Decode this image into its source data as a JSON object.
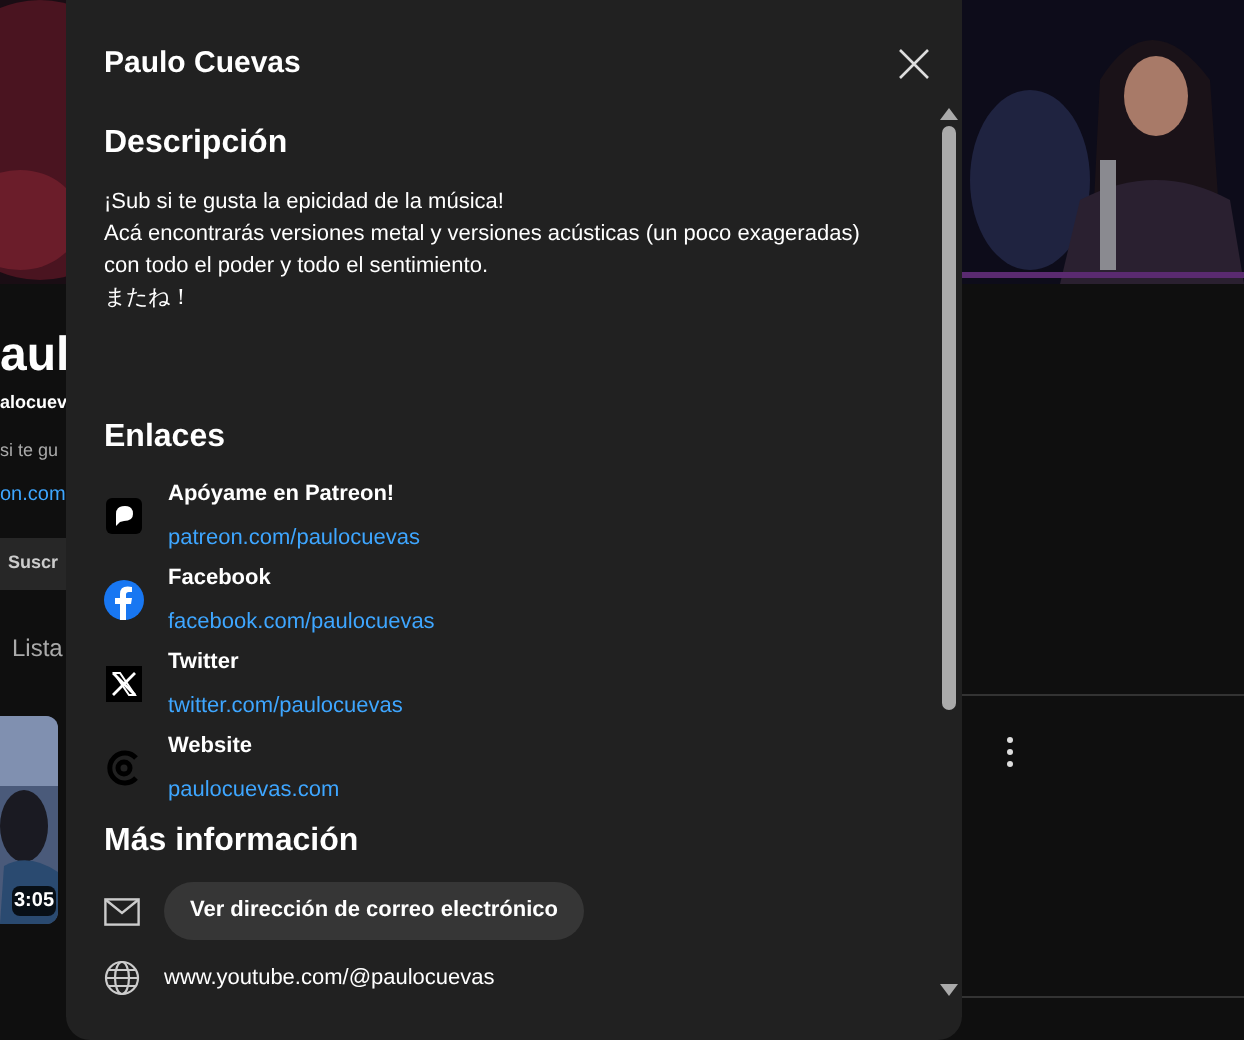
{
  "background_page": {
    "channel_title": "aul",
    "handle": "alocuev",
    "description": "si te gu",
    "link": "on.com",
    "subscribe_button": "Suscr",
    "tab": "Lista",
    "video": {
      "kind": "picture",
      "duration": "3:05"
    }
  },
  "dialog": {
    "title": "Paulo Cuevas",
    "description_heading": "Descripción",
    "description": [
      "¡Sub si te gusta la epicidad de la música!",
      "Acá encontrarás versiones metal y versiones acústicas (un poco exageradas)",
      "con todo el poder y todo el sentimiento.",
      "またね！"
    ],
    "links_heading": "Enlaces",
    "links": [
      {
        "kind": "patreon",
        "title": "Apóyame en Patreon!",
        "url": "patreon.com/paulocuevas"
      },
      {
        "kind": "facebook",
        "title": "Facebook",
        "url": "facebook.com/paulocuevas"
      },
      {
        "kind": "twitter",
        "title": "Twitter",
        "url": "twitter.com/paulocuevas"
      },
      {
        "kind": "website",
        "title": "Website",
        "url": "paulocuevas.com"
      }
    ],
    "more_heading": "Más información",
    "email_button": "Ver dirección de correo electrónico",
    "channel_url": "www.youtube.com/@paulocuevas"
  }
}
